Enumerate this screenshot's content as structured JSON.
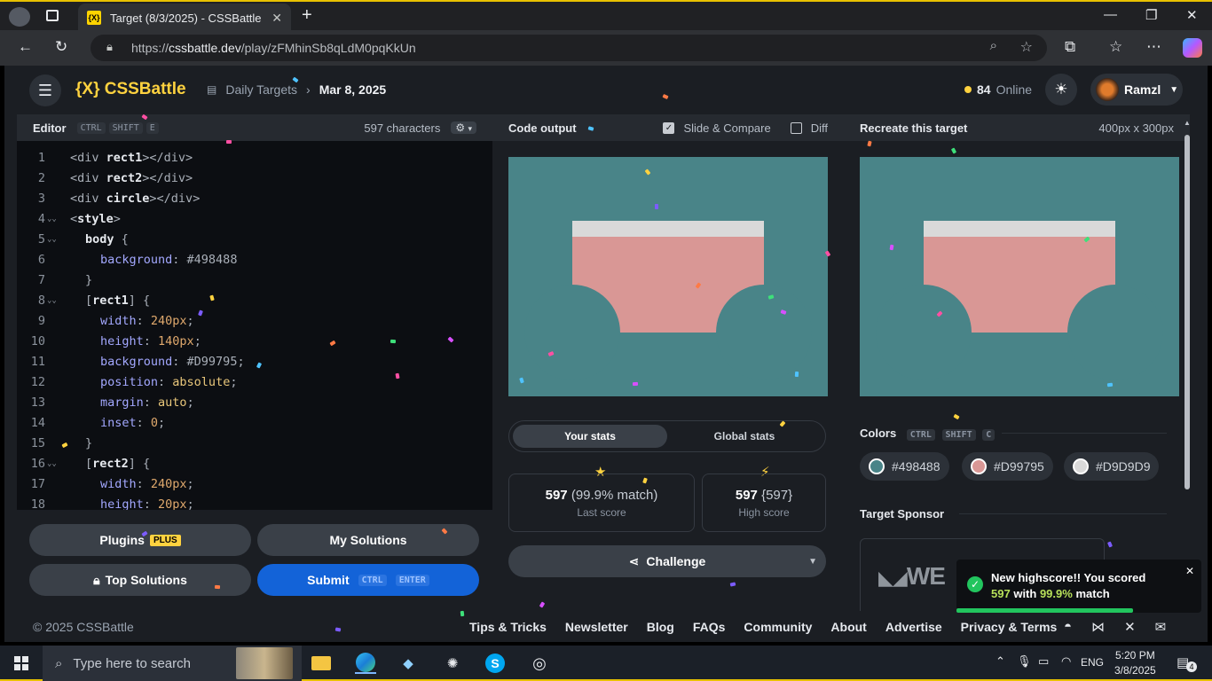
{
  "browser": {
    "tab_title": "Target (8/3/2025) - CSSBattle",
    "favicon_text": "{X}",
    "url_prefix": "https://",
    "url_host": "cssbattle.dev",
    "url_path": "/play/zFMhinSb8qLdM0pqKkUn"
  },
  "nav": {
    "logo": "{X} CSSBattle",
    "breadcrumb_parent": "Daily Targets",
    "breadcrumb_current": "Mar 8, 2025",
    "online_count": "84",
    "online_label": "Online",
    "username": "Ramzl"
  },
  "editor": {
    "title": "Editor",
    "shortcut": [
      "CTRL",
      "SHIFT",
      "E"
    ],
    "chars": "597 characters",
    "gear_caret": "▾",
    "lines": [
      {
        "n": "1",
        "fold": "",
        "indent": 0,
        "parts": [
          [
            "tag",
            "<div "
          ],
          [
            "kw",
            "rect1"
          ],
          [
            "tag",
            "></div>"
          ]
        ]
      },
      {
        "n": "2",
        "fold": "",
        "indent": 0,
        "parts": [
          [
            "tag",
            "<div "
          ],
          [
            "kw",
            "rect2"
          ],
          [
            "tag",
            "></div>"
          ]
        ]
      },
      {
        "n": "3",
        "fold": "",
        "indent": 0,
        "parts": [
          [
            "tag",
            "<div "
          ],
          [
            "kw",
            "circle"
          ],
          [
            "tag",
            "></div>"
          ]
        ]
      },
      {
        "n": "4",
        "fold": "⌄⌄",
        "indent": 0,
        "parts": [
          [
            "tag",
            "<"
          ],
          [
            "kw",
            "style"
          ],
          [
            "tag",
            ">"
          ]
        ]
      },
      {
        "n": "5",
        "fold": "⌄⌄",
        "indent": 1,
        "parts": [
          [
            "kw",
            "body"
          ],
          [
            "tag",
            " {"
          ]
        ]
      },
      {
        "n": "6",
        "fold": "",
        "indent": 2,
        "parts": [
          [
            "prop",
            "background"
          ],
          [
            "tag",
            ": "
          ],
          [
            "tag",
            "#498488"
          ]
        ]
      },
      {
        "n": "7",
        "fold": "",
        "indent": 1,
        "parts": [
          [
            "tag",
            "}"
          ]
        ]
      },
      {
        "n": "8",
        "fold": "⌄⌄",
        "indent": 1,
        "parts": [
          [
            "tag",
            "["
          ],
          [
            "kw",
            "rect1"
          ],
          [
            "tag",
            "] {"
          ]
        ]
      },
      {
        "n": "9",
        "fold": "",
        "indent": 2,
        "parts": [
          [
            "prop",
            "width"
          ],
          [
            "tag",
            ": "
          ],
          [
            "num",
            "240px"
          ],
          [
            "tag",
            ";"
          ]
        ]
      },
      {
        "n": "10",
        "fold": "",
        "indent": 2,
        "parts": [
          [
            "prop",
            "height"
          ],
          [
            "tag",
            ": "
          ],
          [
            "num",
            "140px"
          ],
          [
            "tag",
            ";"
          ]
        ]
      },
      {
        "n": "11",
        "fold": "",
        "indent": 2,
        "parts": [
          [
            "prop",
            "background"
          ],
          [
            "tag",
            ": "
          ],
          [
            "tag",
            "#D99795"
          ],
          [
            "tag",
            ";"
          ]
        ]
      },
      {
        "n": "12",
        "fold": "",
        "indent": 2,
        "parts": [
          [
            "prop",
            "position"
          ],
          [
            "tag",
            ": "
          ],
          [
            "val",
            "absolute"
          ],
          [
            "tag",
            ";"
          ]
        ]
      },
      {
        "n": "13",
        "fold": "",
        "indent": 2,
        "parts": [
          [
            "prop",
            "margin"
          ],
          [
            "tag",
            ": "
          ],
          [
            "val",
            "auto"
          ],
          [
            "tag",
            ";"
          ]
        ]
      },
      {
        "n": "14",
        "fold": "",
        "indent": 2,
        "parts": [
          [
            "prop",
            "inset"
          ],
          [
            "tag",
            ": "
          ],
          [
            "num",
            "0"
          ],
          [
            "tag",
            ";"
          ]
        ]
      },
      {
        "n": "15",
        "fold": "",
        "indent": 1,
        "parts": [
          [
            "tag",
            "}"
          ]
        ]
      },
      {
        "n": "16",
        "fold": "⌄⌄",
        "indent": 1,
        "parts": [
          [
            "tag",
            "["
          ],
          [
            "kw",
            "rect2"
          ],
          [
            "tag",
            "] {"
          ]
        ]
      },
      {
        "n": "17",
        "fold": "",
        "indent": 2,
        "parts": [
          [
            "prop",
            "width"
          ],
          [
            "tag",
            ": "
          ],
          [
            "num",
            "240px"
          ],
          [
            "tag",
            ";"
          ]
        ]
      },
      {
        "n": "18",
        "fold": "",
        "indent": 2,
        "parts": [
          [
            "prop",
            "height"
          ],
          [
            "tag",
            ": "
          ],
          [
            "num",
            "20px"
          ],
          [
            "tag",
            ";"
          ]
        ]
      }
    ]
  },
  "buttons": {
    "plugins": "Plugins",
    "plugins_badge": "PLUS",
    "my_solutions": "My Solutions",
    "top_solutions": "Top Solutions",
    "submit": "Submit",
    "submit_keys": [
      "CTRL",
      "ENTER"
    ]
  },
  "output": {
    "title": "Code output",
    "slide_compare": "Slide & Compare",
    "diff": "Diff",
    "tabs": [
      "Your stats",
      "Global stats"
    ],
    "last_score": "597",
    "last_match": "(99.9% match)",
    "last_label": "Last score",
    "high_score": "597",
    "high_alt": "{597}",
    "high_label": "High score",
    "challenge": "Challenge"
  },
  "target": {
    "title": "Recreate this target",
    "dimensions": "400px x 300px",
    "colors_title": "Colors",
    "colors_shortcut": [
      "CTRL",
      "SHIFT",
      "C"
    ],
    "colors": [
      {
        "hex": "#498488",
        "label": "#498488"
      },
      {
        "hex": "#D99795",
        "label": "#D99795"
      },
      {
        "hex": "#D9D9D9",
        "label": "#D9D9D9"
      }
    ],
    "sponsor_title": "Target Sponsor",
    "sponsor_logo": "WE"
  },
  "toast": {
    "line1": "New highscore!! You scored",
    "score": "597",
    "with": "with",
    "match": "99.9%",
    "match_word": "match",
    "progress": 0.72
  },
  "footer": {
    "copyright": "© 2025 CSSBattle",
    "links": [
      "Tips & Tricks",
      "Newsletter",
      "Blog",
      "FAQs",
      "Community",
      "About",
      "Advertise",
      "Privacy & Terms"
    ]
  },
  "taskbar": {
    "search_placeholder": "Type here to search",
    "lang": "ENG",
    "time": "5:20 PM",
    "date": "3/8/2025",
    "notif_count": "4"
  },
  "colors": {
    "accent": "#FFD23F",
    "submit": "#1363D8",
    "success": "#22C55E"
  }
}
